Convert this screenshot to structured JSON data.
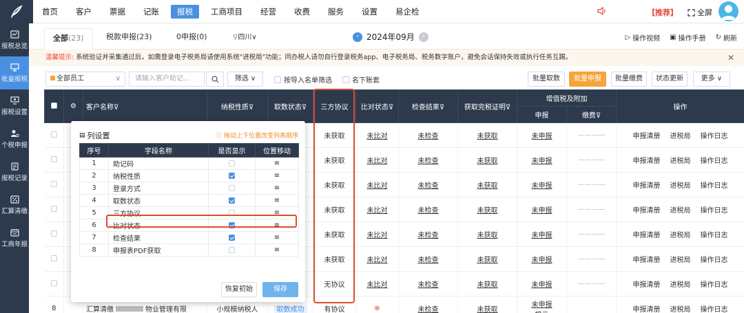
{
  "topnav": [
    {
      "label": "首页"
    },
    {
      "label": "客户"
    },
    {
      "label": "票据"
    },
    {
      "label": "记账"
    },
    {
      "label": "报税",
      "active": true
    },
    {
      "label": "工商项目"
    },
    {
      "label": "经营"
    },
    {
      "label": "收费"
    },
    {
      "label": "服务"
    },
    {
      "label": "设置"
    },
    {
      "label": "易企检"
    }
  ],
  "topbar": {
    "recommend": "【推荐】",
    "fullscreen": "全屏"
  },
  "sidebar": [
    {
      "label": "报税总览",
      "icon": "dashboard-icon"
    },
    {
      "label": "批量报税",
      "icon": "monitor-icon",
      "active": true
    },
    {
      "label": "报税设置",
      "icon": "settings-monitor-icon"
    },
    {
      "label": "个税申报",
      "icon": "person-tax-icon"
    },
    {
      "label": "报税记录",
      "icon": "record-icon"
    },
    {
      "label": "汇算清缴",
      "icon": "percent-icon"
    },
    {
      "label": "工商年报",
      "icon": "annual-report-icon"
    }
  ],
  "tabs": {
    "all": "全部",
    "all_count": "(23)",
    "filed": "税款申报",
    "filed_count": "(23)",
    "zero": "0申报",
    "zero_count": "(0)",
    "region": "四川"
  },
  "month": "2024年09月",
  "links": {
    "video": "操作视频",
    "manual": "操作手册",
    "refresh": "刷新"
  },
  "notice": {
    "hint": "温馨提示:",
    "text": "系统验证并采集通过后，如需登录电子税务局请使用系统\"进税局\"功能；同办税人请勿自行登录税务app、电子税务局、税务数字账户，避免会话保持失效或执行任务互踢。"
  },
  "filters": {
    "staff": "全部员工",
    "search_placeholder": "请输入客户助记...",
    "filter": "筛选",
    "import_filter": "按导入名单筛选",
    "month_accounts": "名下账套",
    "batch_fetch": "批量取数",
    "batch_declare": "批量申报",
    "batch_pay": "批量缴费",
    "status_update": "状态更新",
    "more": "更多"
  },
  "table": {
    "headers": {
      "customer": "客户名称",
      "tax_nature": "纳税性质",
      "fetch_status": "取数状态",
      "tripartite": "三方协议",
      "compare_status": "比对状态",
      "check_result": "检查结果",
      "tax_proof": "获取完税证明",
      "vat_group": "增值税及附加",
      "vat_declare": "申报",
      "vat_pay": "缴费",
      "ops": "操作"
    },
    "rows": [
      {
        "tripartite": "未获取",
        "compare": "未比对",
        "check": "未检查",
        "proof": "未获取",
        "declare": "未申报",
        "pay": "————"
      },
      {
        "tripartite": "未获取",
        "compare": "未比对",
        "check": "未检查",
        "proof": "未获取",
        "declare": "未申报",
        "pay": "————"
      },
      {
        "tripartite": "未获取",
        "compare": "未比对",
        "check": "未检查",
        "proof": "未获取",
        "declare": "未申报",
        "pay": "————"
      },
      {
        "tripartite": "未获取",
        "compare": "未比对",
        "check": "未检查",
        "proof": "未获取",
        "declare": "未申报",
        "pay": "————"
      },
      {
        "tripartite": "未获取",
        "compare": "未比对",
        "check": "未检查",
        "proof": "未获取",
        "declare": "未申报",
        "pay": "————"
      },
      {
        "tripartite": "未获取",
        "compare": "未比对",
        "check": "未检查",
        "proof": "未获取",
        "declare": "未申报",
        "pay": "————"
      },
      {
        "tripartite": "无协议",
        "compare": "未比对",
        "check": "未检查",
        "proof": "未获取",
        "declare": "未申报",
        "pay": "————"
      }
    ],
    "last_row": {
      "no": "8",
      "customer": "汇算清缴",
      "customer_tail": "物业管理有限",
      "nature": "小规模纳税人",
      "fetch": "取数成功",
      "tripartite": "有协议",
      "check": "未检查",
      "proof": "未获取",
      "declare": "未申报",
      "declare2": "提示"
    },
    "ops_labels": [
      "申报清册",
      "进税局",
      "操作日志"
    ]
  },
  "popup": {
    "title": "列设置",
    "tip": "拖动上下位置改变列表顺序",
    "headers": [
      "序号",
      "字段名称",
      "是否显示",
      "位置移动"
    ],
    "rows": [
      {
        "no": "1",
        "name": "助记码",
        "shown": false
      },
      {
        "no": "2",
        "name": "纳税性质",
        "shown": true
      },
      {
        "no": "3",
        "name": "登录方式",
        "shown": false
      },
      {
        "no": "4",
        "name": "取数状态",
        "shown": true
      },
      {
        "no": "5",
        "name": "三方协议",
        "shown": false
      },
      {
        "no": "6",
        "name": "比对状态",
        "shown": true
      },
      {
        "no": "7",
        "name": "检查结果",
        "shown": true
      },
      {
        "no": "8",
        "name": "申报表PDF获取",
        "shown": false
      }
    ],
    "reset": "恢复初始",
    "save": "保存"
  }
}
